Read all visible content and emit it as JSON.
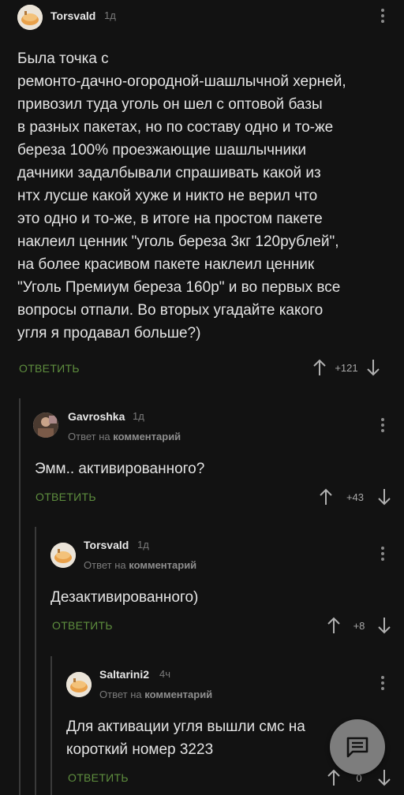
{
  "comments": [
    {
      "author": "Torsvald",
      "time": "1д",
      "text_lines": [
        "Была точка с",
        "ремонто-дачно-огородной-шашлычной херней,",
        "привозил туда  уголь он шел с оптовой базы",
        "в разных пакетах, но по составу одно и то-же",
        "береза 100% проезжающие шашлычники",
        "дачники задалбывали спрашивать какой из",
        "нтх лусше какой хуже и никто не верил что",
        "это одно и то-же, в итоге на простом пакете",
        "наклеил ценник \"уголь береза 3кг 120рублей\",",
        "на более красивом пакете наклеил ценник",
        "\"Уголь Премиум береза 160р\" и во первых все",
        "вопросы отпали. Во вторых угадайте какого",
        "угля я продавал больше?)"
      ],
      "reply_label": "ОТВЕТИТЬ",
      "rating": "+121"
    },
    {
      "author": "Gavroshka",
      "time": "1д",
      "reply_prefix": "Ответ на",
      "reply_target": "комментарий",
      "text_lines": [
        "Эмм.. активированного?"
      ],
      "reply_label": "ОТВЕТИТЬ",
      "rating": "+43"
    },
    {
      "author": "Torsvald",
      "time": "1д",
      "reply_prefix": "Ответ на",
      "reply_target": "комментарий",
      "text_lines": [
        "Дезактивированного)"
      ],
      "reply_label": "ОТВЕТИТЬ",
      "rating": "+8"
    },
    {
      "author": "Saltarini2",
      "time": "4ч",
      "reply_prefix": "Ответ на",
      "reply_target": "комментарий",
      "text_lines": [
        "Для активации угля вышли смс на",
        "короткий номер 3223"
      ],
      "reply_label": "ОТВЕТИТЬ",
      "rating": "0"
    }
  ],
  "icons": {
    "upvote": "arrow-up-icon",
    "downvote": "arrow-down-icon",
    "more": "more-vertical-icon",
    "fab": "comment-icon"
  },
  "colors": {
    "background": "#121212",
    "reply_button": "#5e8e3e",
    "thread_line": "#3a3a3a",
    "fab": "#7d7d7d"
  }
}
